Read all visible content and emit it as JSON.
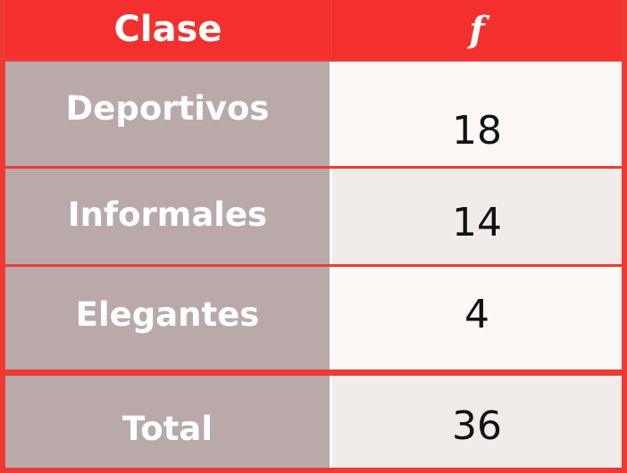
{
  "header": {
    "clase": "Clase",
    "f": "f"
  },
  "rows": [
    {
      "clase": "Deportivos",
      "f": "18"
    },
    {
      "clase": "Informales",
      "f": "14"
    },
    {
      "clase": "Elegantes",
      "f": "4"
    },
    {
      "clase": "Total",
      "f": "36"
    }
  ],
  "colors": {
    "header_bg": "#f3302e",
    "grid": "#ee3a35",
    "label_bg": "#b9aaa9",
    "value_bg_light": "#fdf8f5",
    "value_bg_alt": "#f1ece9"
  }
}
